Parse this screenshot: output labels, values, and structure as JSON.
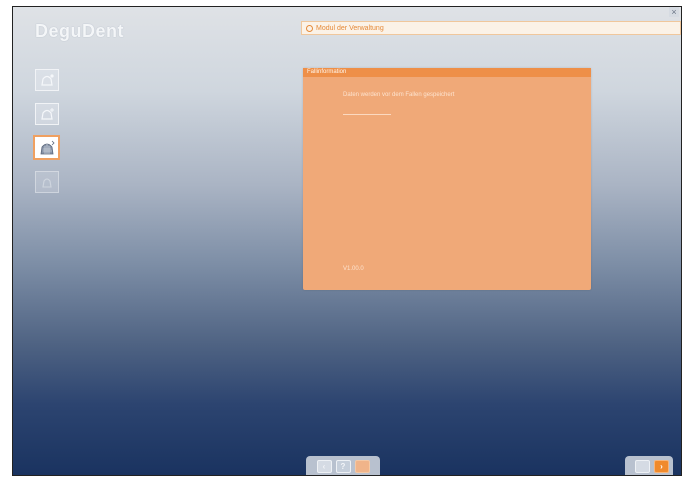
{
  "app": {
    "logo": "DeguDent"
  },
  "window": {
    "close_glyph": "×"
  },
  "topbar": {
    "label": "Modul der Verwaltung",
    "icon": "circle-icon"
  },
  "sidebar": {
    "items": [
      {
        "icon": "bell-icon"
      },
      {
        "icon": "bell-plus-icon"
      },
      {
        "icon": "bell-grid-icon",
        "active": true
      },
      {
        "icon": "bell-disabled-icon",
        "disabled": true
      }
    ]
  },
  "dialog": {
    "title": "Fallinformation",
    "message": "Daten werden vor dem Fallen gespeichert",
    "version": "V1.00.0"
  },
  "bottom_toolbar": {
    "back_label": "‹",
    "help_label": "?",
    "third_label": "",
    "settings_label": "",
    "next_label": "›"
  },
  "colors": {
    "accent": "#f08a2c",
    "dialog_bg": "#f0a978",
    "bg_top": "#dfe2e6",
    "bg_bottom": "#1a3360"
  }
}
